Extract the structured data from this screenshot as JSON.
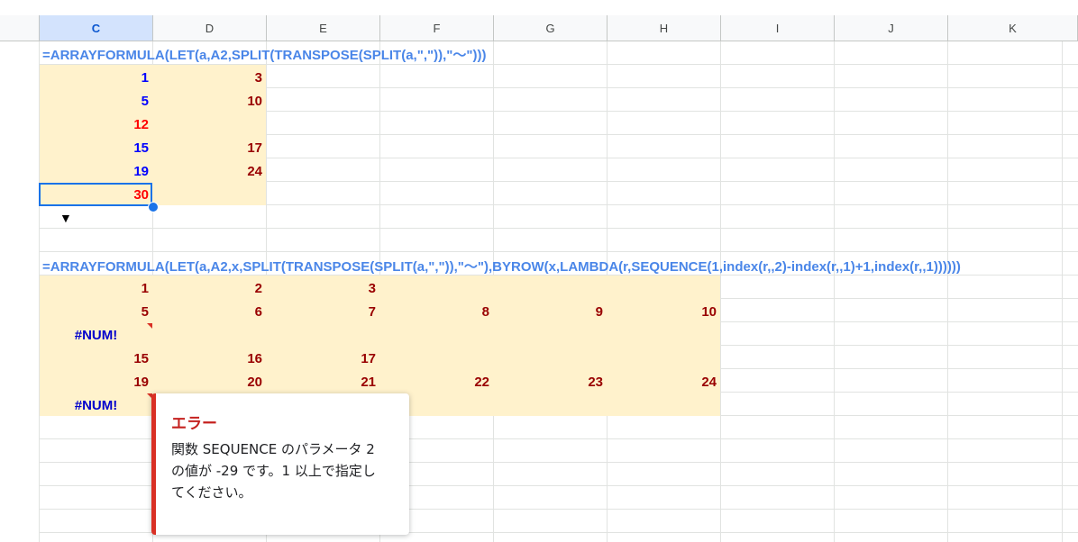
{
  "columns": [
    "C",
    "D",
    "E",
    "F",
    "G",
    "H",
    "I",
    "J",
    "K"
  ],
  "selected_column": "C",
  "formula1": "=ARRAYFORMULA(LET(a,A2,SPLIT(TRANSPOSE(SPLIT(a,\",\")),\"〜\")))",
  "formula2": "=ARRAYFORMULA(LET(a,A2,x,SPLIT(TRANSPOSE(SPLIT(a,\",\")),\"〜\"),BYROW(x,LAMBDA(r,SEQUENCE(1,index(r,,2)-index(r,,1)+1,index(r,,1))))))",
  "block1": {
    "rows": [
      {
        "c": "1",
        "c_color": "blue",
        "d": "3"
      },
      {
        "c": "5",
        "c_color": "blue",
        "d": "10"
      },
      {
        "c": "12",
        "c_color": "red",
        "d": ""
      },
      {
        "c": "15",
        "c_color": "blue",
        "d": "17"
      },
      {
        "c": "19",
        "c_color": "blue",
        "d": "24"
      },
      {
        "c": "30",
        "c_color": "red",
        "d": ""
      }
    ]
  },
  "dropdown_arrow": "▼",
  "block2": {
    "rows": [
      [
        "1",
        "2",
        "3",
        "",
        "",
        ""
      ],
      [
        "5",
        "6",
        "7",
        "8",
        "9",
        "10"
      ],
      [
        "#NUM!",
        "",
        "",
        "",
        "",
        ""
      ],
      [
        "15",
        "16",
        "17",
        "",
        "",
        ""
      ],
      [
        "19",
        "20",
        "21",
        "22",
        "23",
        "24"
      ],
      [
        "#NUM!",
        "",
        "",
        "",
        "",
        ""
      ]
    ]
  },
  "error_popup": {
    "title": "エラー",
    "message": "関数 SEQUENCE のパラメータ 2 の値が -29 です。1 以上で指定してください。"
  },
  "colors": {
    "cell_fill": "#fff2cc",
    "formula_text": "#4a86e8",
    "selection": "#1a73e8",
    "error_accent": "#d93025"
  }
}
